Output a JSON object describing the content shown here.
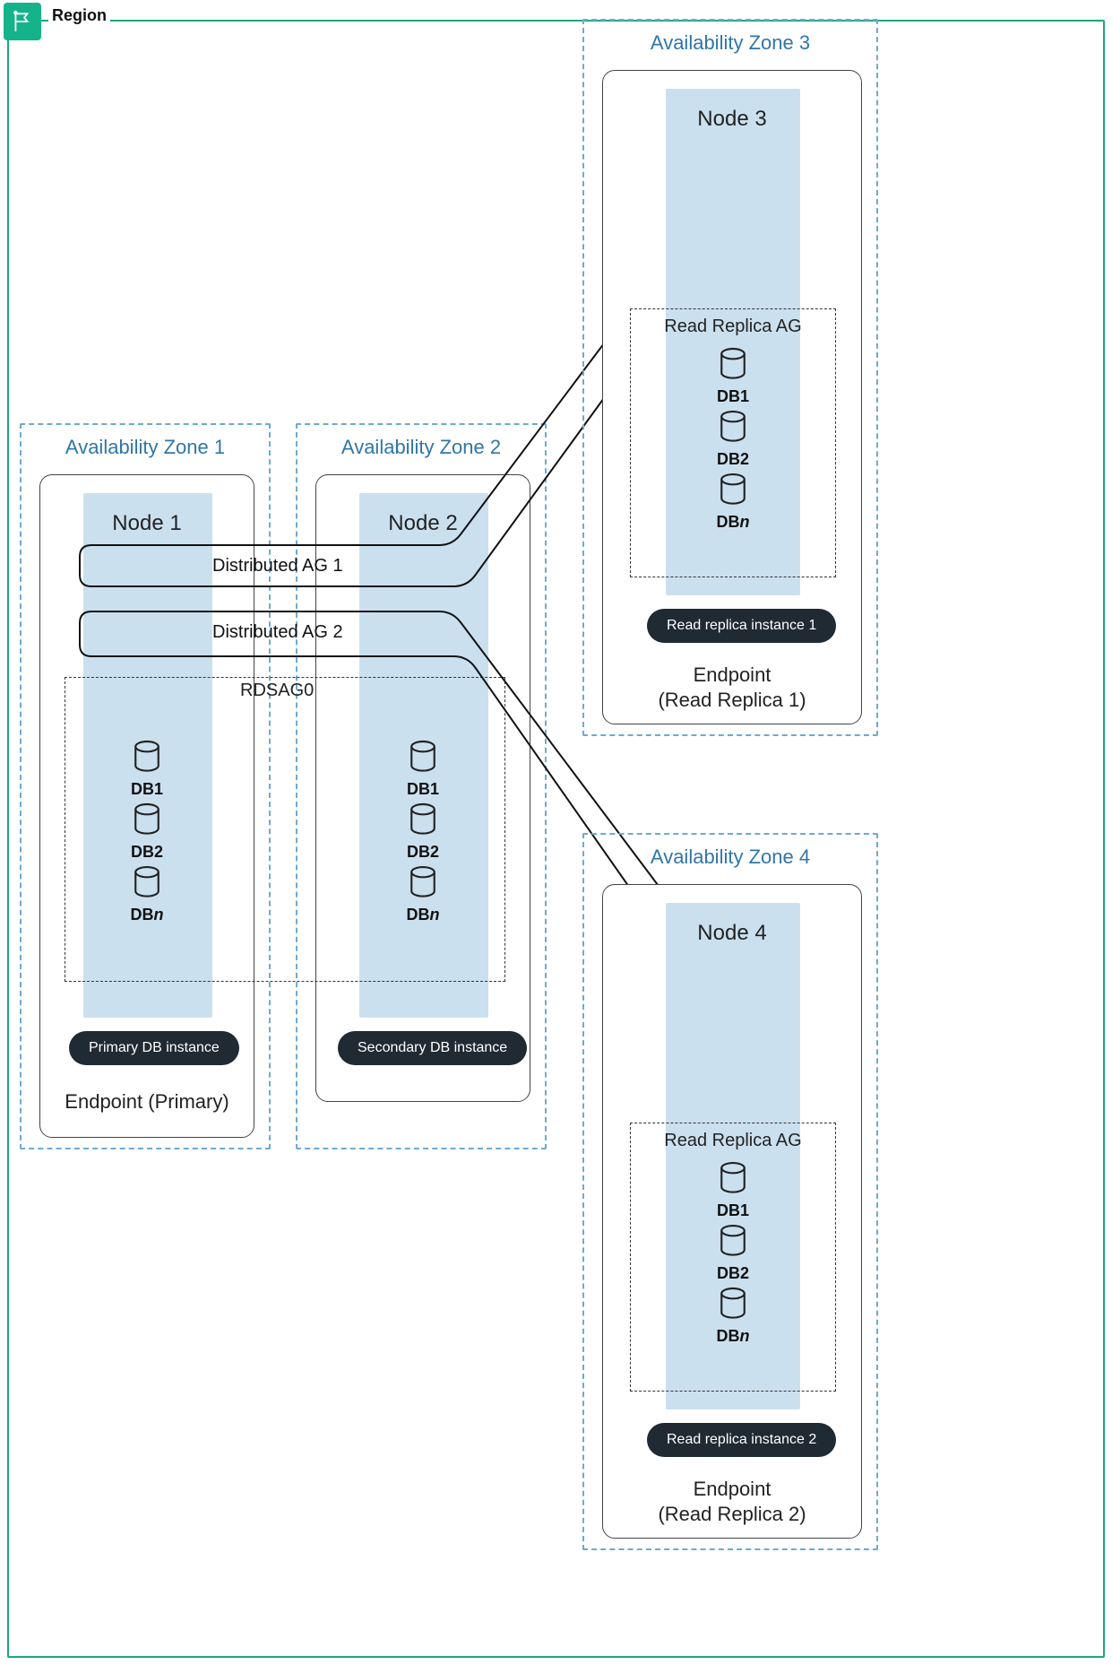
{
  "region": {
    "label": "Region"
  },
  "az1": {
    "title": "Availability Zone 1",
    "nodeTitle": "Node 1",
    "pill": "Primary DB instance",
    "endpoint": "Endpoint (Primary)"
  },
  "az2": {
    "title": "Availability Zone 2",
    "nodeTitle": "Node 2",
    "pill": "Secondary DB instance"
  },
  "az3": {
    "title": "Availability Zone 3",
    "nodeTitle": "Node 3",
    "replicaAg": "Read Replica AG",
    "pill": "Read replica instance 1",
    "endpointL1": "Endpoint",
    "endpointL2": "(Read Replica 1)"
  },
  "az4": {
    "title": "Availability Zone 4",
    "nodeTitle": "Node 4",
    "replicaAg": "Read Replica AG",
    "pill": "Read replica instance 2",
    "endpointL1": "Endpoint",
    "endpointL2": "(Read Replica 2)"
  },
  "rdsag": {
    "label": "RDSAG0"
  },
  "dbs": {
    "db1": "DB1",
    "db2": "DB2",
    "dbnPrefix": "DB",
    "dbnN": "n"
  },
  "distAg": {
    "label1": "Distributed AG 1",
    "label2": "Distributed AG 2"
  }
}
